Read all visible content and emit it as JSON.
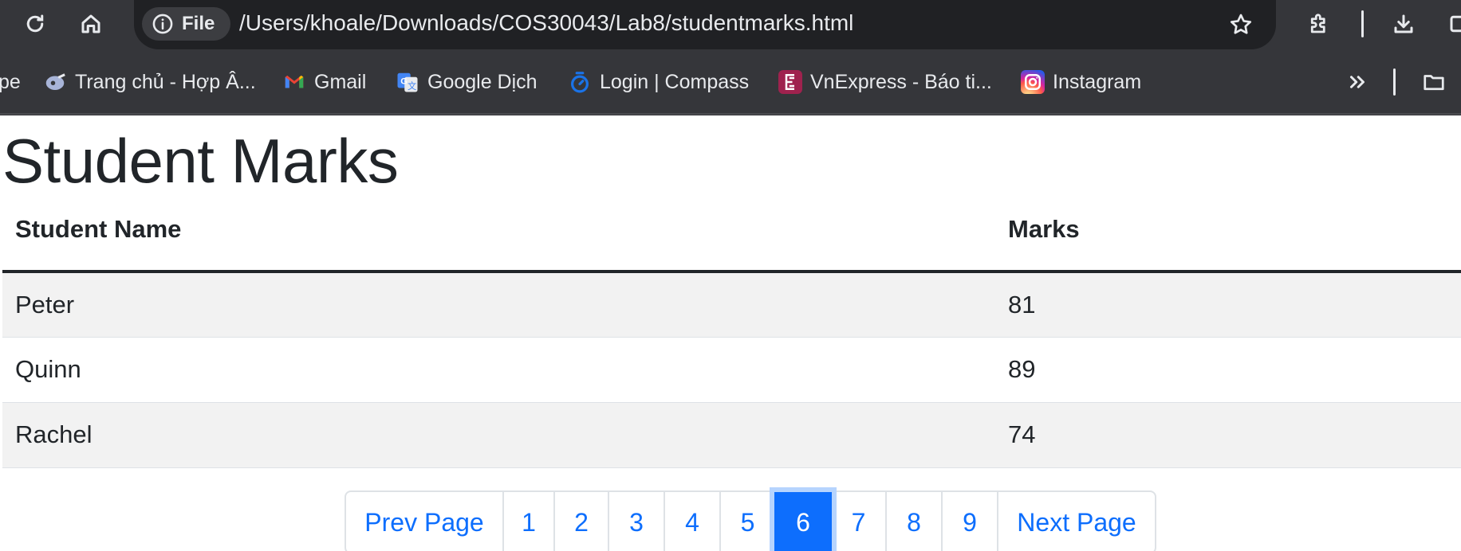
{
  "browser": {
    "file_chip": "File",
    "url": "/Users/khoale/Downloads/COS30043/Lab8/studentmarks.html",
    "bookmarks": [
      {
        "label": "pe",
        "icon": "truncated-bookmark"
      },
      {
        "label": "Trang chủ - Hợp Â...",
        "icon": "guitar-icon"
      },
      {
        "label": "Gmail",
        "icon": "gmail-icon"
      },
      {
        "label": "Google Dịch",
        "icon": "google-translate-icon"
      },
      {
        "label": "Login | Compass",
        "icon": "compass-icon"
      },
      {
        "label": "VnExpress - Báo ti...",
        "icon": "vnexpress-icon"
      },
      {
        "label": "Instagram",
        "icon": "instagram-icon"
      }
    ]
  },
  "page": {
    "title": "Student Marks",
    "table": {
      "headers": [
        "Student Name",
        "Marks"
      ],
      "rows": [
        {
          "name": "Peter",
          "marks": "81"
        },
        {
          "name": "Quinn",
          "marks": "89"
        },
        {
          "name": "Rachel",
          "marks": "74"
        }
      ]
    },
    "pagination": {
      "prev": "Prev Page",
      "pages": [
        "1",
        "2",
        "3",
        "4",
        "5",
        "6",
        "7",
        "8",
        "9"
      ],
      "active": "6",
      "next": "Next Page"
    }
  },
  "colors": {
    "link": "#0d6efd",
    "active_page_bg": "#0d6efd",
    "chrome_bg": "#35363a",
    "omnibox_bg": "#202124",
    "text": "#212529"
  }
}
